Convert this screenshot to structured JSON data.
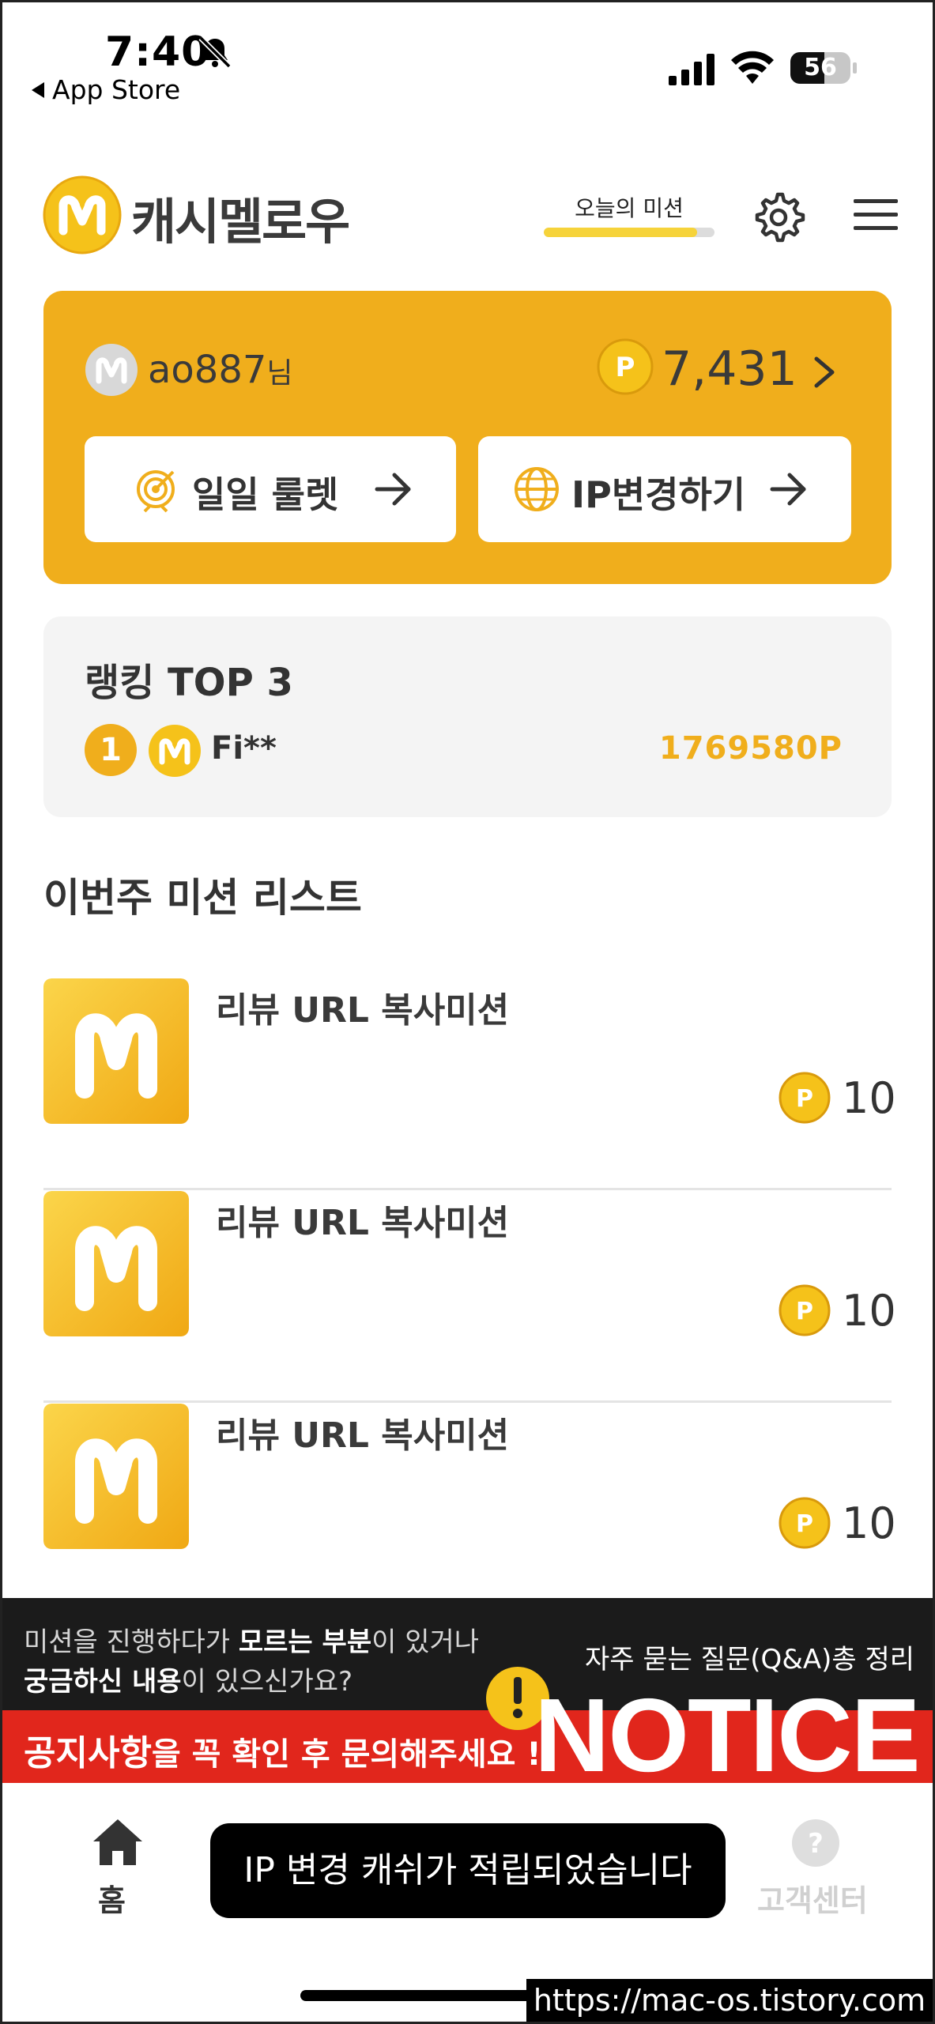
{
  "status_bar": {
    "time": "7:40",
    "back_app": "App Store",
    "battery": "56",
    "battery_level": 0.56
  },
  "header": {
    "brand": "캐시멜로우",
    "mission_tab": "오늘의 미션",
    "mission_progress": 0.9
  },
  "user": {
    "name": "ao887",
    "suffix": "님",
    "balance": "7,431",
    "buttons": [
      {
        "label": "일일 룰렛",
        "icon": "target-icon"
      },
      {
        "label": "IP변경하기",
        "icon": "globe-icon"
      }
    ]
  },
  "ranking": {
    "title": "랭킹 TOP 3",
    "entries": [
      {
        "rank": "1",
        "name": "Fi**",
        "points": "1769580P"
      }
    ]
  },
  "missions": {
    "title": "이번주 미션 리스트",
    "items": [
      {
        "name": "리뷰 URL 복사미션",
        "reward": "10"
      },
      {
        "name": "리뷰 URL 복사미션",
        "reward": "10"
      },
      {
        "name": "리뷰 URL 복사미션",
        "reward": "10"
      }
    ]
  },
  "banner": {
    "line1_a": "미션을 진행하다가 ",
    "line1_b": "모르는 부분",
    "line1_c": "이 있거나",
    "line2_a": "궁금하신 내용",
    "line2_b": "이 있으신가요?",
    "faq": "자주 묻는 질문(Q&A)총 정리",
    "cta_a": "공지사항",
    "cta_b": "을 꼭 확인 후 문의해주세요 !",
    "notice": "NOTICE"
  },
  "tabbar": {
    "home": "홈",
    "help": "고객센터"
  },
  "toast": "IP 변경 캐쉬가 적립되었습니다",
  "watermark": "https://mac-os.tistory.com",
  "colors": {
    "accent": "#f0ae1c",
    "notice_red": "#e1261c",
    "coin": "#f5c21a"
  }
}
